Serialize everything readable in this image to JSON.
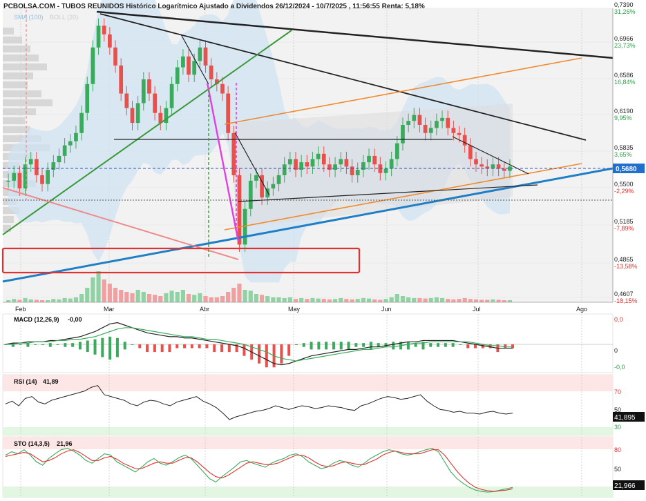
{
  "header": {
    "title": "PCBOLSA.COM - TUBOS REUNIDOS Histórico Logarítmico Ajustado a Dividendos 26/12/2024 - 10/7/2025 , 11:56:55 Renta: 5,18%",
    "legend_sma": "SMA (100)",
    "legend_boll": "BOLL (20)"
  },
  "colors": {
    "up": "#3aaa5c",
    "down": "#e8504c",
    "band": "#cfe3f1",
    "blue_line": "#1f7fc6",
    "orange_line": "#f08a2c",
    "green_line": "#3a9a3a",
    "magenta": "#e040e0",
    "price_badge": "#1f6fd0"
  },
  "chart_data": [
    {
      "type": "candlestick",
      "name": "price",
      "scale": "log",
      "x_ticks": [
        "Feb",
        "Mar",
        "Abr",
        "May",
        "Jun",
        "Jul",
        "Ago"
      ],
      "y_ticks": [
        {
          "value": "0,7390",
          "pct": "31,26%"
        },
        {
          "value": "0,6966",
          "pct": "23,73%"
        },
        {
          "value": "0,6586",
          "pct": "16,84%"
        },
        {
          "value": "0,6190",
          "pct": "9,95%"
        },
        {
          "value": "0,5835",
          "pct": "3,65%"
        },
        {
          "value": "0,5500",
          "pct": "-2,29%"
        },
        {
          "value": "0,5185",
          "pct": "-7,89%"
        },
        {
          "value": "0,4865",
          "pct": "-13,58%"
        },
        {
          "value": "0,4607",
          "pct": "-18,15%"
        }
      ],
      "last_price": "0,5680",
      "ylim": [
        0.4607,
        0.739
      ],
      "closes": [
        0.555,
        0.562,
        0.548,
        0.57,
        0.575,
        0.56,
        0.552,
        0.565,
        0.572,
        0.578,
        0.588,
        0.592,
        0.6,
        0.62,
        0.65,
        0.69,
        0.715,
        0.705,
        0.69,
        0.67,
        0.64,
        0.625,
        0.61,
        0.63,
        0.655,
        0.64,
        0.62,
        0.61,
        0.625,
        0.65,
        0.668,
        0.68,
        0.66,
        0.675,
        0.69,
        0.67,
        0.655,
        0.65,
        0.64,
        0.6,
        0.56,
        0.5,
        0.53,
        0.555,
        0.56,
        0.54,
        0.548,
        0.552,
        0.56,
        0.57,
        0.575,
        0.565,
        0.572,
        0.568,
        0.575,
        0.58,
        0.57,
        0.565,
        0.57,
        0.575,
        0.568,
        0.56,
        0.565,
        0.572,
        0.578,
        0.57,
        0.562,
        0.566,
        0.575,
        0.59,
        0.608,
        0.612,
        0.618,
        0.608,
        0.6,
        0.605,
        0.612,
        0.615,
        0.605,
        0.6,
        0.598,
        0.588,
        0.575,
        0.57,
        0.568,
        0.566,
        0.57,
        0.566,
        0.564,
        0.568
      ],
      "volume_relative": [
        0.05,
        0.08,
        0.06,
        0.1,
        0.07,
        0.06,
        0.05,
        0.05,
        0.08,
        0.07,
        0.1,
        0.09,
        0.12,
        0.2,
        0.35,
        0.6,
        0.75,
        0.55,
        0.45,
        0.35,
        0.3,
        0.25,
        0.22,
        0.3,
        0.25,
        0.2,
        0.18,
        0.15,
        0.22,
        0.28,
        0.25,
        0.3,
        0.2,
        0.18,
        0.22,
        0.15,
        0.12,
        0.12,
        0.15,
        0.25,
        0.35,
        0.45,
        0.3,
        0.28,
        0.2,
        0.18,
        0.15,
        0.12,
        0.12,
        0.1,
        0.12,
        0.08,
        0.1,
        0.08,
        0.1,
        0.09,
        0.08,
        0.07,
        0.08,
        0.1,
        0.08,
        0.07,
        0.08,
        0.1,
        0.09,
        0.07,
        0.06,
        0.08,
        0.12,
        0.2,
        0.15,
        0.12,
        0.1,
        0.1,
        0.09,
        0.1,
        0.12,
        0.1,
        0.08,
        0.07,
        0.08,
        0.1,
        0.08,
        0.07,
        0.06,
        0.06,
        0.07,
        0.06,
        0.05,
        0.05
      ]
    },
    {
      "type": "line",
      "name": "MACD",
      "title": "MACD (12,26,9)",
      "value": "-0,00",
      "y_ticks": [
        "0,0",
        "0",
        "-0,0"
      ],
      "macd": [
        0.0,
        0.001,
        0.001,
        0.002,
        0.002,
        0.002,
        0.003,
        0.003,
        0.004,
        0.005,
        0.006,
        0.008,
        0.01,
        0.013,
        0.016,
        0.017,
        0.015,
        0.013,
        0.011,
        0.009,
        0.008,
        0.007,
        0.006,
        0.006,
        0.005,
        0.005,
        0.004,
        0.003,
        0.002,
        0.001,
        0.0,
        -0.001,
        -0.003,
        -0.006,
        -0.009,
        -0.012,
        -0.015,
        -0.016,
        -0.015,
        -0.013,
        -0.011,
        -0.009,
        -0.008,
        -0.007,
        -0.006,
        -0.005,
        -0.004,
        -0.004,
        -0.003,
        -0.002,
        -0.002,
        -0.001,
        0.0,
        0.001,
        0.002,
        0.002,
        0.003,
        0.003,
        0.003,
        0.003,
        0.003,
        0.002,
        0.001,
        0.0,
        -0.001,
        -0.002,
        -0.003,
        -0.003,
        -0.003
      ],
      "signal": [
        0.0,
        0.0,
        0.001,
        0.001,
        0.002,
        0.002,
        0.002,
        0.003,
        0.003,
        0.004,
        0.004,
        0.005,
        0.006,
        0.008,
        0.01,
        0.012,
        0.013,
        0.013,
        0.012,
        0.011,
        0.01,
        0.009,
        0.008,
        0.007,
        0.006,
        0.006,
        0.005,
        0.004,
        0.004,
        0.003,
        0.002,
        0.001,
        0.0,
        -0.002,
        -0.004,
        -0.006,
        -0.009,
        -0.011,
        -0.012,
        -0.013,
        -0.012,
        -0.011,
        -0.01,
        -0.009,
        -0.008,
        -0.007,
        -0.006,
        -0.005,
        -0.004,
        -0.004,
        -0.003,
        -0.002,
        -0.002,
        -0.001,
        0.0,
        0.001,
        0.001,
        0.002,
        0.002,
        0.002,
        0.002,
        0.002,
        0.002,
        0.001,
        0.0,
        -0.001,
        -0.001,
        -0.002,
        -0.002
      ]
    },
    {
      "type": "line",
      "name": "RSI",
      "title": "RSI (14)",
      "value": "41,89",
      "last_value": "41,895",
      "y_ticks": [
        "70",
        "50",
        "30"
      ],
      "ylim": [
        20,
        80
      ],
      "values": [
        52,
        55,
        50,
        58,
        60,
        54,
        52,
        56,
        58,
        60,
        62,
        64,
        66,
        70,
        72,
        62,
        60,
        58,
        56,
        52,
        50,
        54,
        56,
        55,
        52,
        50,
        54,
        56,
        58,
        60,
        55,
        52,
        48,
        42,
        35,
        38,
        40,
        42,
        44,
        45,
        47,
        50,
        48,
        46,
        48,
        50,
        49,
        47,
        48,
        50,
        49,
        48,
        46,
        45,
        50,
        52,
        55,
        58,
        60,
        59,
        57,
        58,
        60,
        62,
        55,
        50,
        46,
        45,
        43,
        44,
        42,
        42,
        41,
        43,
        44,
        42,
        41,
        42
      ]
    },
    {
      "type": "line",
      "name": "STO",
      "title": "STO (14,3,5)",
      "value": "21,96",
      "last_value": "21,966",
      "y_ticks": [
        "80",
        "50"
      ],
      "ylim": [
        10,
        90
      ],
      "k": [
        70,
        75,
        72,
        78,
        70,
        60,
        55,
        65,
        72,
        78,
        80,
        76,
        70,
        62,
        58,
        65,
        72,
        70,
        60,
        55,
        50,
        45,
        52,
        60,
        65,
        58,
        55,
        60,
        66,
        70,
        65,
        55,
        45,
        35,
        30,
        38,
        45,
        52,
        60,
        62,
        58,
        55,
        52,
        58,
        62,
        65,
        70,
        72,
        68,
        60,
        55,
        50,
        52,
        58,
        62,
        60,
        55,
        52,
        58,
        65,
        70,
        75,
        78,
        76,
        72,
        70,
        72,
        75,
        78,
        80,
        75,
        60,
        45,
        35,
        28,
        22,
        18,
        16,
        15,
        16,
        18,
        20,
        22
      ],
      "d": [
        68,
        70,
        72,
        74,
        72,
        66,
        60,
        62,
        66,
        72,
        76,
        78,
        74,
        68,
        62,
        62,
        66,
        68,
        64,
        58,
        54,
        50,
        50,
        54,
        58,
        60,
        58,
        58,
        62,
        66,
        66,
        60,
        52,
        44,
        38,
        36,
        40,
        46,
        52,
        58,
        60,
        58,
        56,
        56,
        58,
        62,
        66,
        70,
        70,
        66,
        60,
        55,
        53,
        54,
        58,
        60,
        58,
        56,
        56,
        60,
        64,
        70,
        74,
        76,
        74,
        72,
        72,
        72,
        75,
        78,
        78,
        70,
        58,
        46,
        36,
        28,
        22,
        19,
        17,
        16,
        17,
        18,
        20
      ]
    }
  ]
}
